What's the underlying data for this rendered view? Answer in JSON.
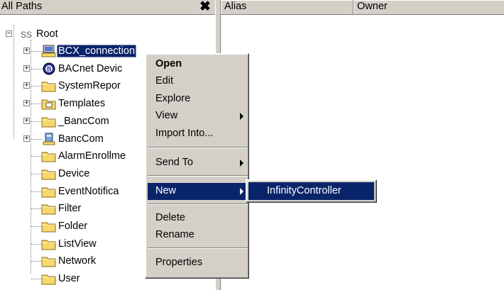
{
  "left_pane": {
    "title": "All Paths",
    "close_glyph": "✖"
  },
  "list_columns": [
    "Alias",
    "Owner"
  ],
  "tree": {
    "root_label": "Root",
    "root_icon": "scope-icon",
    "items": [
      {
        "label": "BCX_connection",
        "icon": "computer-icon",
        "expander": "+",
        "selected": true
      },
      {
        "label": "BACnet Devic",
        "icon": "bacnet-icon",
        "expander": "+"
      },
      {
        "label": "SystemRepor",
        "icon": "folder-icon",
        "expander": "+"
      },
      {
        "label": "Templates",
        "icon": "template-folder-icon",
        "expander": "+"
      },
      {
        "label": "_BancCom",
        "icon": "folder-icon",
        "expander": "+"
      },
      {
        "label": "BancCom",
        "icon": "device-icon",
        "expander": "+"
      },
      {
        "label": "AlarmEnrollme",
        "icon": "folder-icon"
      },
      {
        "label": "Device",
        "icon": "folder-icon"
      },
      {
        "label": "EventNotifica",
        "icon": "folder-icon"
      },
      {
        "label": "Filter",
        "icon": "folder-icon"
      },
      {
        "label": "Folder",
        "icon": "folder-icon"
      },
      {
        "label": "ListView",
        "icon": "folder-icon"
      },
      {
        "label": "Network",
        "icon": "folder-icon"
      },
      {
        "label": "User",
        "icon": "folder-icon"
      }
    ]
  },
  "context_menu": {
    "items": [
      {
        "label": "Open",
        "bold": true
      },
      {
        "label": "Edit"
      },
      {
        "label": "Explore"
      },
      {
        "label": "View",
        "submenu": true
      },
      {
        "label": "Import Into..."
      },
      {
        "label": "Send To",
        "submenu": true
      },
      {
        "label": "New",
        "submenu": true,
        "highlighted": true
      },
      {
        "label": "Delete"
      },
      {
        "label": "Rename"
      },
      {
        "label": "Properties"
      }
    ]
  },
  "submenu": {
    "items": [
      {
        "label": "InfinityController"
      }
    ]
  },
  "colors": {
    "selection": "#0a246a",
    "chrome": "#d4d0c8",
    "folder": "#f5d76e"
  }
}
